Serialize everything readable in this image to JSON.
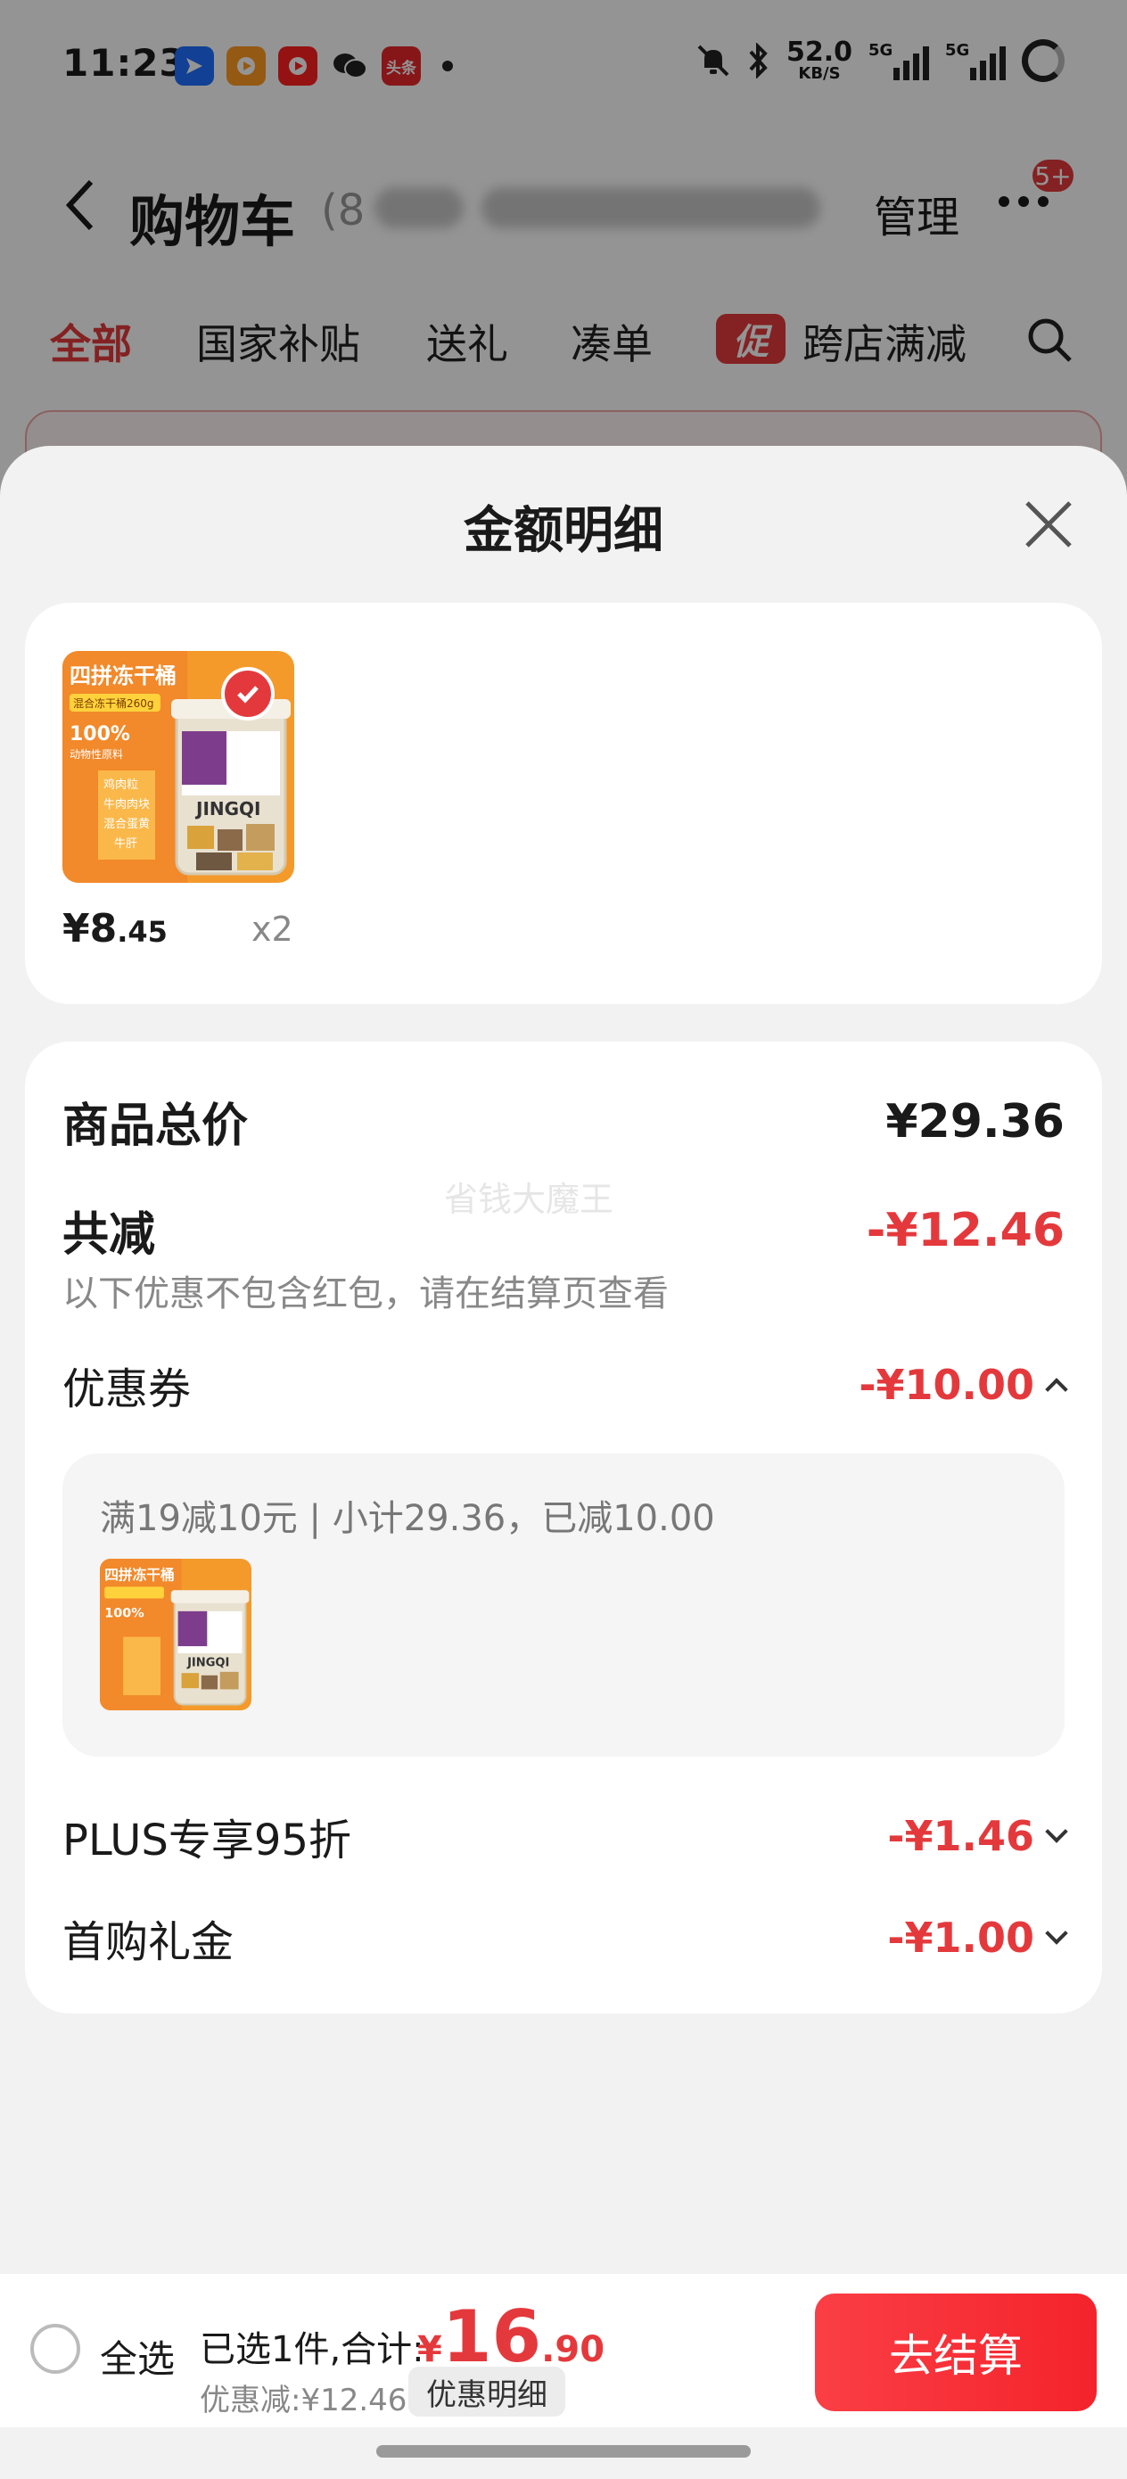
{
  "status_bar": {
    "time": "11:23",
    "app_icons": [
      "location-app-icon",
      "video-app-icon",
      "youtube-app-icon",
      "wechat-icon",
      "toutiao-icon"
    ],
    "toutiao_label": "头条",
    "net_speed_value": "52.0",
    "net_speed_unit": "KB/S",
    "sim1_label": "5G",
    "sim2_label": "5G"
  },
  "header": {
    "title": "购物车",
    "count_prefix": "(8",
    "manage_label": "管理",
    "badge": "5+"
  },
  "tabs": [
    {
      "label": "全部",
      "active": true
    },
    {
      "label": "国家补贴",
      "active": false
    },
    {
      "label": "送礼",
      "active": false
    },
    {
      "label": "凑单",
      "active": false
    },
    {
      "label": "跨店满减",
      "active": false
    }
  ],
  "promo_tag": "促",
  "sheet": {
    "title": "金额明细",
    "product": {
      "price_int": "¥8",
      "price_dec": ".45",
      "qty": "x2",
      "image_text": {
        "brand": "四拼冻干桶",
        "sub": "混合冻干桶260g",
        "pct": "100%",
        "desc": "动物性原料",
        "items": [
          "鸡肉粒",
          "牛肉肉块",
          "混合蛋黄",
          "牛肝"
        ],
        "can_label": "JINGQI"
      }
    },
    "summary": {
      "total_label": "商品总价",
      "total_value": "¥29.36",
      "discount_label": "共减",
      "discount_value": "-¥12.46",
      "note": "以下优惠不包含红包，请在结算页查看",
      "watermark": "省钱大魔王"
    },
    "coupon": {
      "label": "优惠券",
      "value": "-¥10.00",
      "detail": "满19减10元 | 小计29.36，已减10.00"
    },
    "plus": {
      "label": "PLUS专享95折",
      "value": "-¥1.46"
    },
    "first_buy": {
      "label": "首购礼金",
      "value": "-¥1.00"
    }
  },
  "action_bar": {
    "select_all": "全选",
    "selected_info": "已选1件,合计:",
    "total_currency": "¥",
    "total_int": "16",
    "total_dec": ".90",
    "discount_info": "优惠减:¥12.46",
    "detail_button": "优惠明细",
    "checkout_button": "去结算"
  },
  "colors": {
    "accent": "#e4393c",
    "sheet_bg": "#f2f2f2",
    "card_bg": "#ffffff"
  }
}
